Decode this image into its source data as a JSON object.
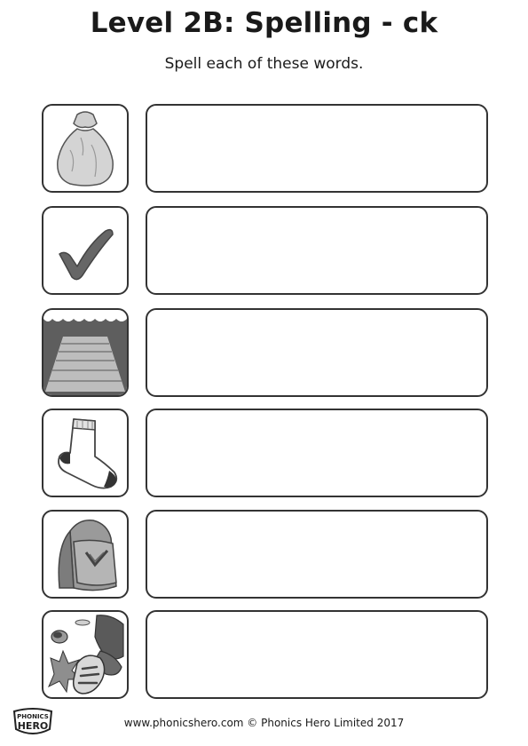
{
  "header": {
    "title": "Level 2B: Spelling - ck",
    "subtitle": "Spell each of these words."
  },
  "rows": [
    {
      "icon": "sack-icon",
      "answer": ""
    },
    {
      "icon": "tick-icon",
      "answer": ""
    },
    {
      "icon": "dock-icon",
      "answer": ""
    },
    {
      "icon": "sock-icon",
      "answer": ""
    },
    {
      "icon": "backpack-icon",
      "answer": ""
    },
    {
      "icon": "kick-icon",
      "answer": ""
    }
  ],
  "footer": {
    "text": "www.phonicshero.com © Phonics Hero Limited 2017",
    "logo_text": "PHONICS HERO"
  }
}
